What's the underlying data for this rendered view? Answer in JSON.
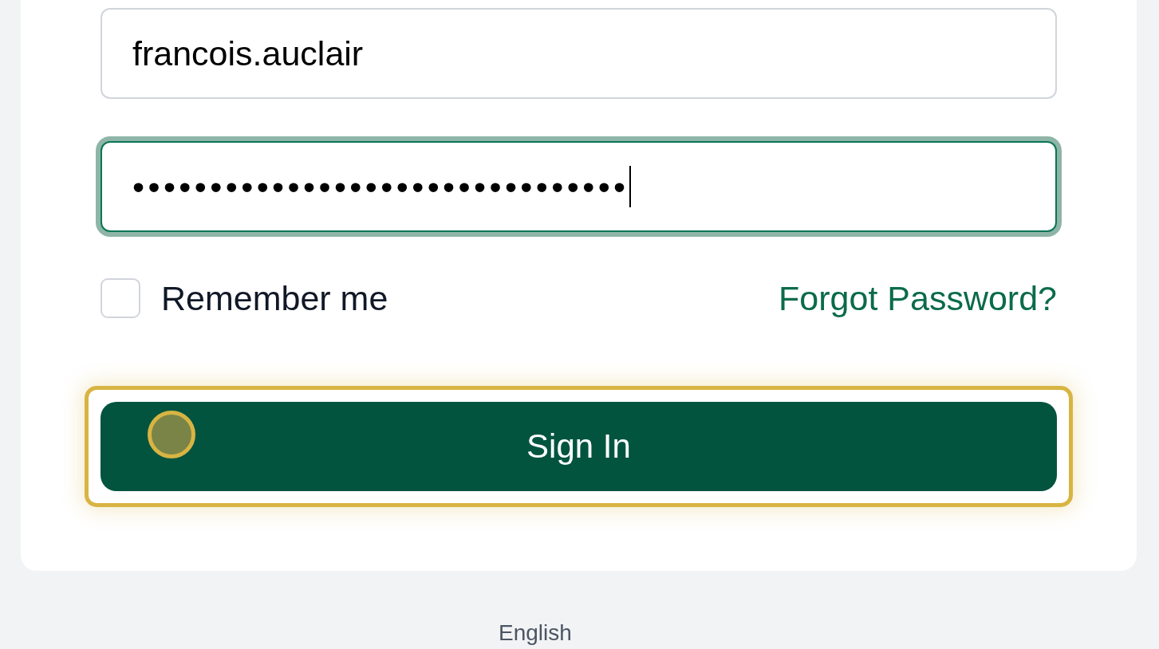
{
  "login_form": {
    "username_field": {
      "value": "francois.auclair"
    },
    "password_field": {
      "value": "••••••••••••••••••••••••••••••••",
      "focused": true
    },
    "remember_me": {
      "label": "Remember me",
      "checked": false
    },
    "forgot_password_link": {
      "label": "Forgot Password?"
    },
    "sign_in_button": {
      "label": "Sign In",
      "highlighted": true
    }
  },
  "language": {
    "label": "English"
  }
}
